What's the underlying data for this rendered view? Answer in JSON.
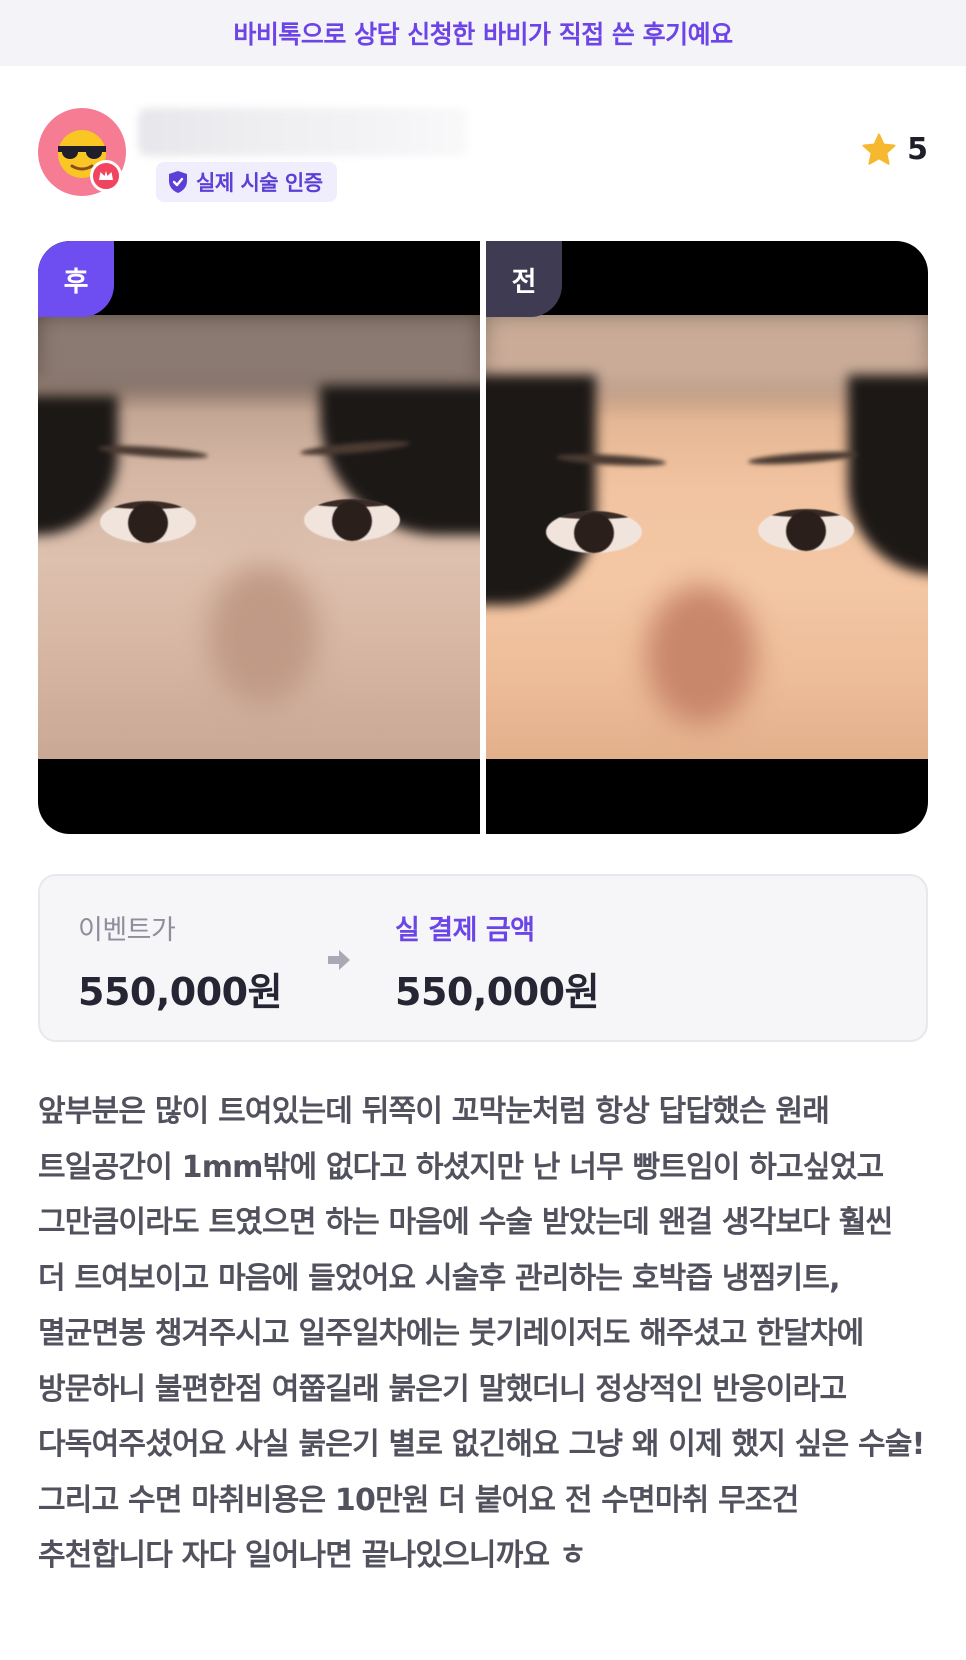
{
  "banner": {
    "text": "바비톡으로 상담 신청한 바비가 직접 쓴 후기예요",
    "color": "#6d44e6"
  },
  "reviewer": {
    "avatar_icon": "sunglasses-emoji-avatar",
    "badge_label": "실제 시술 인증",
    "badge_icon": "shield-check-icon"
  },
  "rating": {
    "icon": "star-icon",
    "value": "5",
    "star_color": "#f5b82e"
  },
  "photos": {
    "after_label": "후",
    "before_label": "전",
    "after_label_color": "#6e4ef0",
    "before_label_color": "#3f3b53"
  },
  "price": {
    "event_label": "이벤트가",
    "event_value": "550,000원",
    "arrow_icon": "arrow-right-icon",
    "paid_label": "실 결제 금액",
    "paid_value": "550,000원",
    "paid_label_color": "#6b45e8"
  },
  "review": {
    "text": "앞부분은 많이 트여있는데 뒤쪽이 꼬막눈처럼 항상 답답했슨 원래 트일공간이 1mm밖에 없다고 하셨지만 난 너무 빵트임이 하고싶었고 그만큼이라도 트였으면 하는 마음에 수술 받았는데 왠걸 생각보다 훨씬 더 트여보이고 마음에 들었어요 시술후 관리하는 호박즙 냉찜키트,멸균면봉 챙겨주시고 일주일차에는 붓기레이저도 해주셨고 한달차에 방문하니 불편한점 여쭙길래 붉은기 말했더니 정상적인 반응이라고 다독여주셨어요  사실 붉은기 별로 없긴해요 그냥 왜 이제 했지 싶은 수술! 그리고 수면 마취비용은 10만원 더 붙어요 전 수면마취 무조건 추천합니다 자다 일어나면 끝나있으니까요 ㅎ"
  }
}
